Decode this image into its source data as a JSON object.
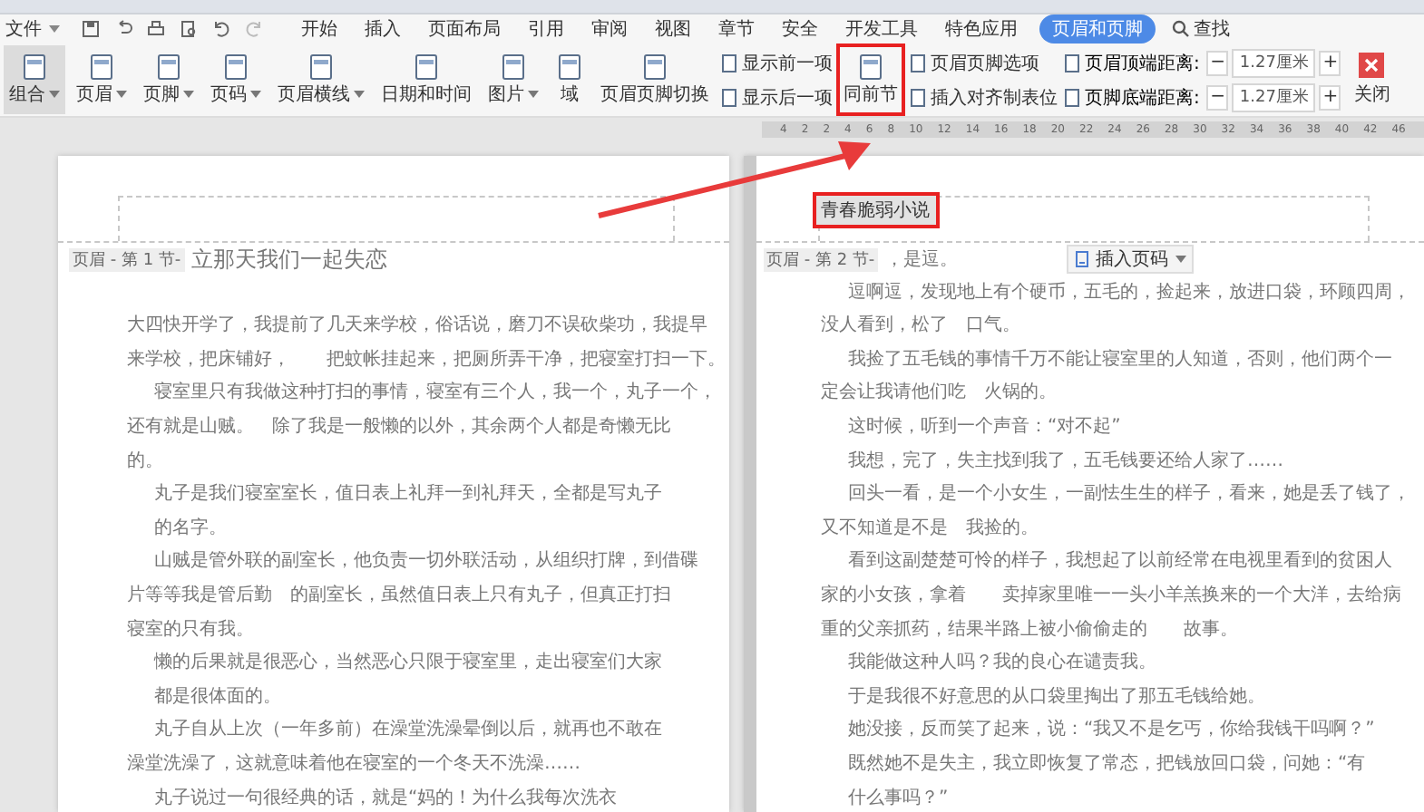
{
  "menu_bar": {
    "file_menu": "文件",
    "tabs": [
      {
        "label": "开始",
        "selected": false
      },
      {
        "label": "插入",
        "selected": false
      },
      {
        "label": "页面布局",
        "selected": false
      },
      {
        "label": "引用",
        "selected": false
      },
      {
        "label": "审阅",
        "selected": false
      },
      {
        "label": "视图",
        "selected": false
      },
      {
        "label": "章节",
        "selected": false
      },
      {
        "label": "安全",
        "selected": false
      },
      {
        "label": "开发工具",
        "selected": false
      },
      {
        "label": "特色应用",
        "selected": false
      },
      {
        "label": "页眉和页脚",
        "selected": true
      }
    ],
    "search": "查找"
  },
  "ribbon": {
    "items": [
      {
        "kind": "large",
        "label": "组合",
        "caret": true,
        "pressed": true,
        "highlighted": false
      },
      {
        "kind": "large",
        "label": "页眉",
        "caret": true,
        "pressed": false,
        "highlighted": false
      },
      {
        "kind": "large",
        "label": "页脚",
        "caret": true,
        "pressed": false,
        "highlighted": false
      },
      {
        "kind": "large",
        "label": "页码",
        "caret": true,
        "pressed": false,
        "highlighted": false
      },
      {
        "kind": "large",
        "label": "页眉横线",
        "caret": true,
        "pressed": false,
        "highlighted": false
      },
      {
        "kind": "large",
        "label": "日期和时间",
        "caret": false,
        "pressed": false,
        "highlighted": false
      },
      {
        "kind": "large",
        "label": "图片",
        "caret": true,
        "pressed": false,
        "highlighted": false
      },
      {
        "kind": "large",
        "label": "域",
        "caret": false,
        "pressed": false,
        "highlighted": false
      },
      {
        "kind": "large",
        "label": "页眉页脚切换",
        "caret": false,
        "pressed": false,
        "highlighted": false
      },
      {
        "kind": "stack",
        "buttons": [
          "显示前一项",
          "显示后一项"
        ]
      },
      {
        "kind": "large",
        "label": "同前节",
        "caret": false,
        "pressed": false,
        "highlighted": true
      },
      {
        "kind": "stack",
        "buttons": [
          "页眉页脚选项",
          "插入对齐制表位"
        ]
      },
      {
        "kind": "spin",
        "rows": [
          {
            "label": "页眉顶端距离:",
            "minus": "−",
            "value": "1.27厘米",
            "plus": "+"
          },
          {
            "label": "页脚底端距离:",
            "minus": "−",
            "value": "1.27厘米",
            "plus": "+"
          }
        ]
      },
      {
        "kind": "close",
        "label": "关闭"
      }
    ]
  },
  "ruler": {
    "numbers": [
      "4",
      "2",
      "2",
      "4",
      "6",
      "8",
      "10",
      "12",
      "14",
      "16",
      "18",
      "20",
      "22",
      "24",
      "26",
      "28",
      "30",
      "32",
      "34",
      "36",
      "38",
      "40",
      "42",
      "46"
    ]
  },
  "pages": [
    {
      "section_tag": "页眉 - 第 1 节-",
      "first_line": "立那天我们一起失恋",
      "lines": [
        {
          "text": "大四快开学了，我提前了几天来学校，俗话说，磨刀不误砍柴功，我提早",
          "indent": false
        },
        {
          "text": "来学校，把床铺好，　　把蚊帐挂起来，把厕所弄干净，把寝室打扫一下。",
          "indent": false
        },
        {
          "text": "寝室里只有我做这种打扫的事情，寝室有三个人，我一个，丸子一个，",
          "indent": true
        },
        {
          "text": "还有就是山贼。　除了我是一般懒的以外，其余两个人都是奇懒无比",
          "indent": false
        },
        {
          "text": "的。",
          "indent": false
        },
        {
          "text": "丸子是我们寝室室长，值日表上礼拜一到礼拜天，全都是写丸子",
          "indent": true
        },
        {
          "text": "的名字。",
          "indent": true
        },
        {
          "text": "山贼是管外联的副室长，他负责一切外联活动，从组织打牌，到借碟",
          "indent": true
        },
        {
          "text": "片等等我是管后勤　的副室长，虽然值日表上只有丸子，但真正打扫",
          "indent": false
        },
        {
          "text": "寝室的只有我。",
          "indent": false
        },
        {
          "text": "懒的后果就是很恶心，当然恶心只限于寝室里，走出寝室们大家",
          "indent": true
        },
        {
          "text": "都是很体面的。",
          "indent": true
        },
        {
          "text": "丸子自从上次（一年多前）在澡堂洗澡晕倒以后，就再也不敢在",
          "indent": true
        },
        {
          "text": "澡堂洗澡了，这就意味着他在寝室的一个冬天不洗澡……",
          "indent": false
        },
        {
          "text": "丸子说过一句很经典的话，就是“妈的！为什么我每次洗衣",
          "indent": true
        }
      ]
    },
    {
      "header_text": "青春脆弱小说",
      "header_highlighted": true,
      "section_tag": "页眉 - 第 2 节-",
      "first_line": "，是逗。",
      "insert_page_number": "插入页码",
      "lines": [
        {
          "text": "逗啊逗，发现地上有个硬币，五毛的，捡起来，放进口袋，环顾四周，",
          "indent": true
        },
        {
          "text": "没人看到，松了　口气。",
          "indent": false
        },
        {
          "text": "我捡了五毛钱的事情千万不能让寝室里的人知道，否则，他们两个一",
          "indent": true
        },
        {
          "text": "定会让我请他们吃　火锅的。",
          "indent": false
        },
        {
          "text": "这时候，听到一个声音：“对不起”",
          "indent": true
        },
        {
          "text": "我想，完了，失主找到我了，五毛钱要还给人家了……",
          "indent": true
        },
        {
          "text": "回头一看，是一个小女生，一副怯生生的样子，看来，她是丢了钱了，",
          "indent": true
        },
        {
          "text": "又不知道是不是　我捡的。",
          "indent": false
        },
        {
          "text": "看到这副楚楚可怜的样子，我想起了以前经常在电视里看到的贫困人",
          "indent": true
        },
        {
          "text": "家的小女孩，拿着　　卖掉家里唯一一头小羊羔换来的一个大洋，去给病",
          "indent": false
        },
        {
          "text": "重的父亲抓药，结果半路上被小偷偷走的　　故事。",
          "indent": false
        },
        {
          "text": "我能做这种人吗？我的良心在谴责我。",
          "indent": true
        },
        {
          "text": "于是我很不好意思的从口袋里掏出了那五毛钱给她。",
          "indent": true
        },
        {
          "text": "她没接，反而笑了起来，说：“我又不是乞丐，你给我钱干吗啊？”",
          "indent": true
        },
        {
          "text": "既然她不是失主，我立即恢复了常态，把钱放回口袋，问她：“有",
          "indent": true
        },
        {
          "text": "什么事吗？”",
          "indent": true
        }
      ]
    }
  ]
}
